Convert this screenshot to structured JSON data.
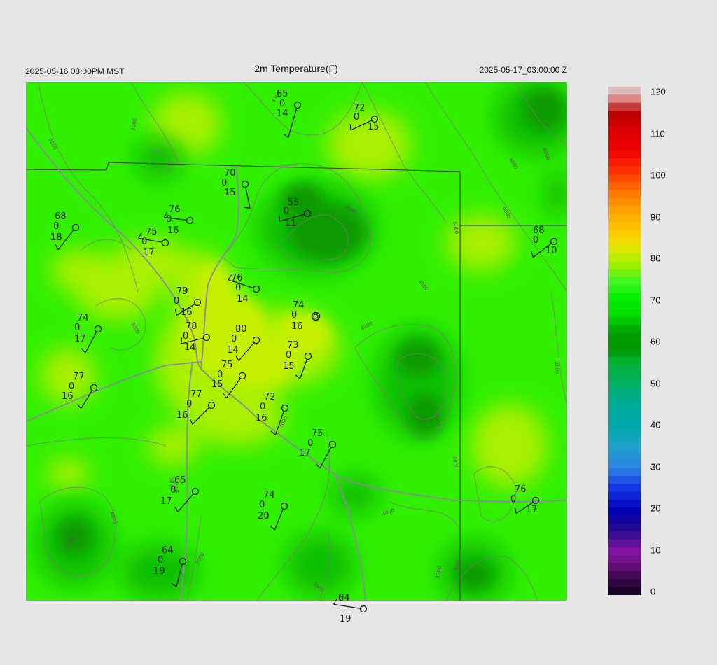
{
  "header": {
    "local_time": "2025-05-16 08:00PM MST",
    "title": "2m Temperature(F)",
    "utc_time": "2025-05-17_03:00:00 Z"
  },
  "colorbar": {
    "min": 0,
    "max": 120,
    "labels": [
      "120",
      "110",
      "100",
      "90",
      "80",
      "70",
      "60",
      "50",
      "40",
      "30",
      "20",
      "10",
      "0"
    ],
    "stops": [
      {
        "v": 0,
        "c": "#10001a"
      },
      {
        "v": 5,
        "c": "#4a0a5e"
      },
      {
        "v": 10,
        "c": "#8a14a6"
      },
      {
        "v": 15,
        "c": "#2a0a8c"
      },
      {
        "v": 20,
        "c": "#0000b4"
      },
      {
        "v": 25,
        "c": "#1432e6"
      },
      {
        "v": 30,
        "c": "#2c82e6"
      },
      {
        "v": 35,
        "c": "#1ea0c8"
      },
      {
        "v": 40,
        "c": "#00a8aa"
      },
      {
        "v": 45,
        "c": "#00aa9a"
      },
      {
        "v": 50,
        "c": "#00b064"
      },
      {
        "v": 55,
        "c": "#00b432"
      },
      {
        "v": 58,
        "c": "#009600"
      },
      {
        "v": 62,
        "c": "#00a000"
      },
      {
        "v": 66,
        "c": "#00dc00"
      },
      {
        "v": 70,
        "c": "#00f000"
      },
      {
        "v": 74,
        "c": "#40f820"
      },
      {
        "v": 78,
        "c": "#a0f000"
      },
      {
        "v": 82,
        "c": "#e6e600"
      },
      {
        "v": 86,
        "c": "#ffc800"
      },
      {
        "v": 90,
        "c": "#ffaa00"
      },
      {
        "v": 95,
        "c": "#ff7800"
      },
      {
        "v": 100,
        "c": "#ff3200"
      },
      {
        "v": 105,
        "c": "#f00000"
      },
      {
        "v": 110,
        "c": "#dc0000"
      },
      {
        "v": 114,
        "c": "#b40000"
      },
      {
        "v": 117,
        "c": "#e08080"
      },
      {
        "v": 120,
        "c": "#d8d8d8"
      }
    ]
  },
  "field_colors": {
    "base": "#30f000",
    "warm": "#a8f000",
    "warmer": "#c4f000",
    "cool": "#10c000",
    "cooler": "#0a9a00"
  },
  "contour_labels": [
    "2000",
    "3000",
    "4000",
    "5000"
  ],
  "stations": [
    {
      "t": "65",
      "z": "0",
      "d": "14"
    },
    {
      "t": "72",
      "z": "0",
      "d": "15"
    },
    {
      "t": "70",
      "z": "0",
      "d": "15"
    },
    {
      "t": "55",
      "z": "0",
      "d": "11"
    },
    {
      "t": "68",
      "z": "0",
      "d": "18"
    },
    {
      "t": "76",
      "z": "0",
      "d": "16"
    },
    {
      "t": "75",
      "z": "0",
      "d": "17"
    },
    {
      "t": "68",
      "z": "0",
      "d": "10"
    },
    {
      "t": "76",
      "z": "0",
      "d": "14"
    },
    {
      "t": "79",
      "z": "0",
      "d": "16"
    },
    {
      "t": "74",
      "z": "0",
      "d": "16"
    },
    {
      "t": "74",
      "z": "0",
      "d": "17"
    },
    {
      "t": "78",
      "z": "0",
      "d": "14"
    },
    {
      "t": "80",
      "z": "0",
      "d": "14"
    },
    {
      "t": "73",
      "z": "0",
      "d": "15"
    },
    {
      "t": "77",
      "z": "0",
      "d": "16"
    },
    {
      "t": "75",
      "z": "0",
      "d": "15"
    },
    {
      "t": "77",
      "z": "0",
      "d": "16"
    },
    {
      "t": "72",
      "z": "0",
      "d": "16"
    },
    {
      "t": "75",
      "z": "0",
      "d": "17"
    },
    {
      "t": "65",
      "z": "0",
      "d": "17"
    },
    {
      "t": "76",
      "z": "0",
      "d": "17"
    },
    {
      "t": "74",
      "z": "0",
      "d": "20"
    },
    {
      "t": "64",
      "z": "0",
      "d": "19"
    },
    {
      "t": "64",
      "z": "0",
      "d": "19"
    }
  ]
}
